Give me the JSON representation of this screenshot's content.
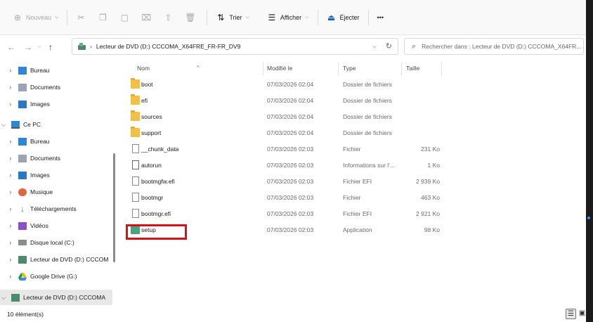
{
  "toolbar": {
    "new_label": "Nouveau",
    "sort_label": "Trier",
    "view_label": "Afficher",
    "eject_label": "Éjecter",
    "more_label": "•••"
  },
  "address": {
    "path": "Lecteur de DVD (D:) CCCOMA_X64FRE_FR-FR_DV9",
    "search_placeholder": "Rechercher dans : Lecteur de DVD (D:) CCCOMA_X64FR..."
  },
  "sidebar": {
    "items": [
      {
        "label": "Bureau"
      },
      {
        "label": "Documents"
      },
      {
        "label": "Images"
      },
      {
        "label": "Ce PC"
      },
      {
        "label": "Bureau"
      },
      {
        "label": "Documents"
      },
      {
        "label": "Images"
      },
      {
        "label": "Musique"
      },
      {
        "label": "Téléchargements"
      },
      {
        "label": "Vidéos"
      },
      {
        "label": "Disque local (C:)"
      },
      {
        "label": "Lecteur de DVD (D:) CCCOM"
      },
      {
        "label": "Google Drive (G:)"
      },
      {
        "label": "Lecteur de DVD (D:) CCCOMA"
      }
    ]
  },
  "columns": {
    "name": "Nom",
    "modified": "Modifié le",
    "type": "Type",
    "size": "Taille"
  },
  "files": [
    {
      "name": "boot",
      "modified": "07/03/2026 02:04",
      "type": "Dossier de fichiers",
      "size": ""
    },
    {
      "name": "efi",
      "modified": "07/03/2026 02:04",
      "type": "Dossier de fichiers",
      "size": ""
    },
    {
      "name": "sources",
      "modified": "07/03/2026 02:04",
      "type": "Dossier de fichiers",
      "size": ""
    },
    {
      "name": "support",
      "modified": "07/03/2026 02:04",
      "type": "Dossier de fichiers",
      "size": ""
    },
    {
      "name": "__chunk_data",
      "modified": "07/03/2026 02:03",
      "type": "Fichier",
      "size": "231 Ko"
    },
    {
      "name": "autorun",
      "modified": "07/03/2026 02:03",
      "type": "Informations sur l'...",
      "size": "1 Ko"
    },
    {
      "name": "bootmgfw.efi",
      "modified": "07/03/2026 02:03",
      "type": "Fichier EFI",
      "size": "2 939 Ko"
    },
    {
      "name": "bootmgr",
      "modified": "07/03/2026 02:03",
      "type": "Fichier",
      "size": "463 Ko"
    },
    {
      "name": "bootmgr.efi",
      "modified": "07/03/2026 02:03",
      "type": "Fichier EFI",
      "size": "2 921 Ko"
    },
    {
      "name": "setup",
      "modified": "07/03/2026 02:03",
      "type": "Application",
      "size": "98 Ko"
    }
  ],
  "status": {
    "count": "10 élément(s)"
  }
}
